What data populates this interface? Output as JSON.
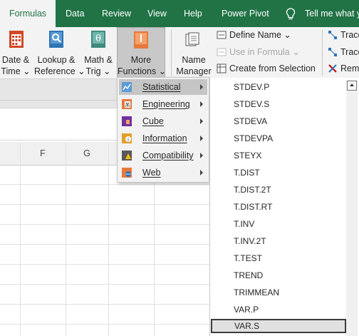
{
  "tabs": [
    {
      "label": "Formulas",
      "active": true
    },
    {
      "label": "Data"
    },
    {
      "label": "Review"
    },
    {
      "label": "View"
    },
    {
      "label": "Help"
    },
    {
      "label": "Power Pivot"
    }
  ],
  "tell_me": "Tell me what y",
  "ribbon": {
    "date_time": [
      "Date &",
      "Time ⌄"
    ],
    "lookup": [
      "Lookup &",
      "Reference ⌄"
    ],
    "math": [
      "Math &",
      "Trig ⌄"
    ],
    "more_functions": [
      "More",
      "Functions ⌄"
    ],
    "name_manager": [
      "Name",
      "Manager"
    ],
    "define_name": "Define Name  ⌄",
    "use_in_formula": "Use in Formula ⌄",
    "create_from_selection": "Create from Selection",
    "trace_precedents": "Trace",
    "trace_dependents": "Trace",
    "remove_arrows": "Rem"
  },
  "columns": [
    "F",
    "G"
  ],
  "menu": [
    {
      "label": "Statistical",
      "highlighted": true
    },
    {
      "label": "Engineering"
    },
    {
      "label": "Cube"
    },
    {
      "label": "Information"
    },
    {
      "label": "Compatibility"
    },
    {
      "label": "Web"
    }
  ],
  "functions": [
    "STDEV.P",
    "STDEV.S",
    "STDEVA",
    "STDEVPA",
    "STEYX",
    "T.DIST",
    "T.DIST.2T",
    "T.DIST.RT",
    "T.INV",
    "T.INV.2T",
    "T.TEST",
    "TREND",
    "TRIMMEAN",
    "VAR.P",
    "VAR.S"
  ],
  "selected_function": "VAR.S",
  "colors": {
    "accent": "#217346"
  }
}
